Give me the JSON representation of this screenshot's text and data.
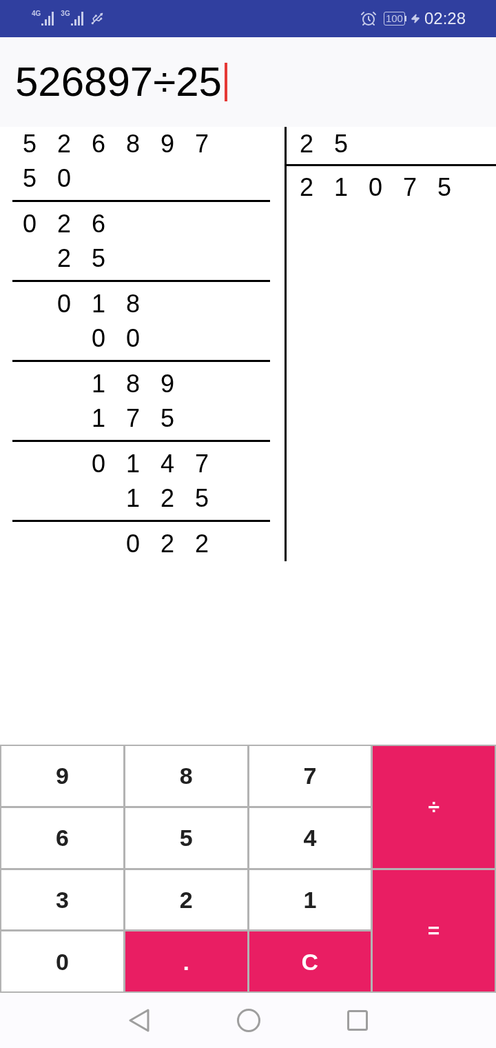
{
  "status_bar": {
    "networks": [
      {
        "label": "4G"
      },
      {
        "label": "3G"
      }
    ],
    "battery": "100",
    "time": "02:28"
  },
  "display": {
    "expression": "526897÷25"
  },
  "long_division": {
    "dividend": [
      "5",
      "2",
      "6",
      "8",
      "9",
      "7"
    ],
    "divisor": [
      "2",
      "5"
    ],
    "quotient": [
      "2",
      "1",
      "0",
      "7",
      "5"
    ],
    "steps": [
      {
        "subtrahend": [
          "5",
          "0"
        ],
        "remainder": [
          "0",
          "2",
          "6"
        ]
      },
      {
        "subtrahend": [
          "2",
          "5"
        ],
        "remainder": [
          "0",
          "1",
          "8"
        ]
      },
      {
        "subtrahend": [
          "0",
          "0"
        ],
        "remainder": [
          "1",
          "8",
          "9"
        ]
      },
      {
        "subtrahend": [
          "1",
          "7",
          "5"
        ],
        "remainder": [
          "0",
          "1",
          "4",
          "7"
        ]
      },
      {
        "subtrahend": [
          "1",
          "2",
          "5"
        ],
        "remainder": [
          "0",
          "2",
          "2"
        ]
      }
    ]
  },
  "keypad": [
    {
      "label": "9",
      "kind": "digit"
    },
    {
      "label": "8",
      "kind": "digit"
    },
    {
      "label": "7",
      "kind": "digit"
    },
    {
      "label": "÷",
      "kind": "operator"
    },
    {
      "label": "6",
      "kind": "digit"
    },
    {
      "label": "5",
      "kind": "digit"
    },
    {
      "label": "4",
      "kind": "digit"
    },
    {
      "label": "3",
      "kind": "digit"
    },
    {
      "label": "2",
      "kind": "digit"
    },
    {
      "label": "1",
      "kind": "digit"
    },
    {
      "label": "=",
      "kind": "operator"
    },
    {
      "label": "0",
      "kind": "digit"
    },
    {
      "label": ".",
      "kind": "function"
    },
    {
      "label": "C",
      "kind": "function"
    }
  ]
}
